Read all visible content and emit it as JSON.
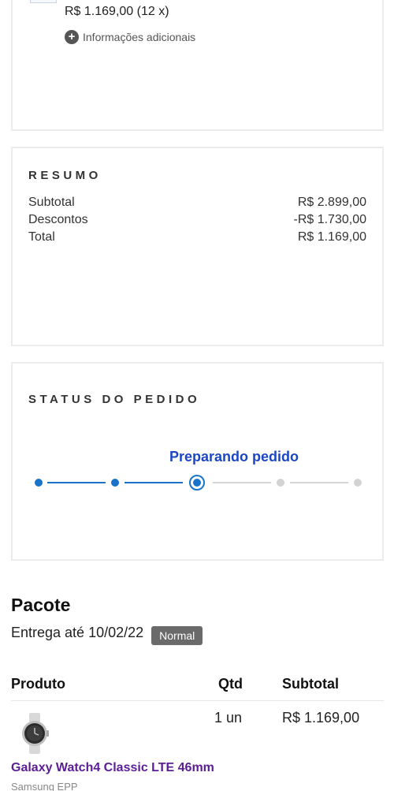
{
  "top_card": {
    "installment_price": "R$ 1.169,00 (12 x)",
    "more_info_label": "Informações adicionais"
  },
  "resumo": {
    "title": "RESUMO",
    "rows": [
      {
        "label": "Subtotal",
        "value": "R$ 2.899,00"
      },
      {
        "label": "Descontos",
        "value": "-R$ 1.730,00"
      },
      {
        "label": "Total",
        "value": "R$ 1.169,00"
      }
    ]
  },
  "status": {
    "title": "STATUS DO PEDIDO",
    "current_step_label": "Preparando pedido",
    "total_steps": 5,
    "current_step": 3,
    "colors": {
      "done": "#1a73c9",
      "todo": "#d3d3d3",
      "current_label": "#1b47c4"
    }
  },
  "pacote": {
    "title": "Pacote",
    "delivery_text": "Entrega até 10/02/22",
    "shipping_badge": "Normal",
    "columns": [
      "Produto",
      "Qtd",
      "Subtotal"
    ],
    "items": [
      {
        "name": "Galaxy Watch4 Classic LTE 46mm",
        "seller": "Samsung EPP",
        "qty": "1 un",
        "subtotal": "R$ 1.169,00",
        "image_icon": "smartwatch-icon"
      }
    ]
  }
}
